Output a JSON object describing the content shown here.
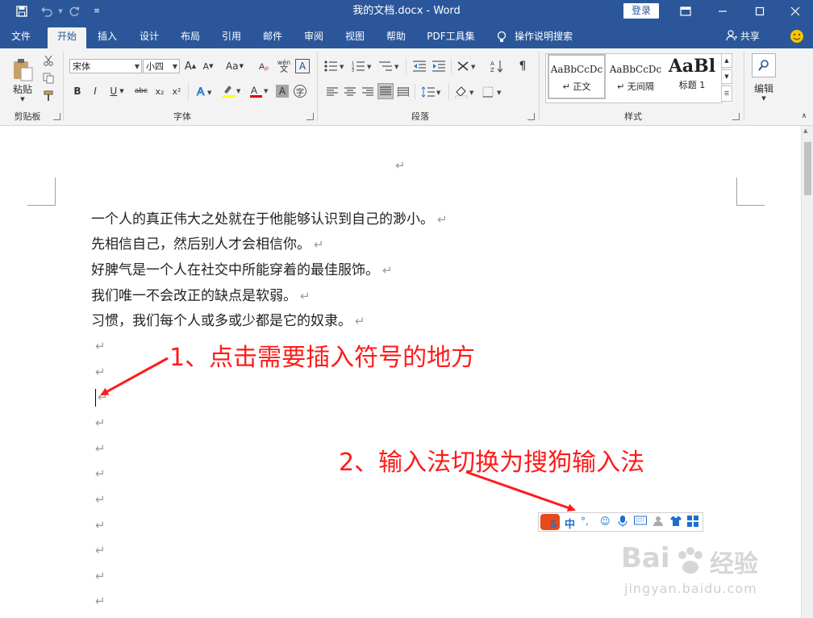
{
  "titlebar": {
    "title": "我的文档.docx - Word",
    "login_label": "登录"
  },
  "tabs": [
    "文件",
    "开始",
    "插入",
    "设计",
    "布局",
    "引用",
    "邮件",
    "审阅",
    "视图",
    "帮助",
    "PDF工具集",
    "操作说明搜索"
  ],
  "share_label": "共享",
  "ribbon": {
    "clipboard": {
      "paste_label": "粘贴",
      "group_label": "剪贴板"
    },
    "font": {
      "font_name": "宋体",
      "font_size": "小四",
      "group_label": "字体",
      "grow": "A",
      "shrink": "A",
      "case": "Aa",
      "wen": "wén",
      "bold": "B",
      "italic": "I",
      "underline": "U",
      "strike": "abc",
      "sub": "x₂",
      "sup": "x²"
    },
    "paragraph": {
      "group_label": "段落"
    },
    "styles": {
      "group_label": "样式",
      "items": [
        {
          "preview": "AaBbCcDc",
          "name": "↵ 正文"
        },
        {
          "preview": "AaBbCcDc",
          "name": "↵ 无间隔"
        },
        {
          "preview": "AaBl",
          "name": "标题 1"
        }
      ]
    },
    "editing": {
      "label": "编辑"
    }
  },
  "document": {
    "top_mark": "↵",
    "paragraphs": [
      "一个人的真正伟大之处就在于他能够认识到自己的渺小。",
      "先相信自己，然后别人才会相信你。",
      "好脾气是一个人在社交中所能穿着的最佳服饰。",
      "我们唯一不会改正的缺点是软弱。",
      "习惯，我们每个人或多或少都是它的奴隶。"
    ],
    "mark": "↵"
  },
  "annotations": {
    "step1": "1、点击需要插入符号的地方",
    "step2": "2、输入法切换为搜狗输入法",
    "color": "#ff1a1a"
  },
  "ime": {
    "logo": "S",
    "mode": "中",
    "punct": "°,"
  },
  "watermark": {
    "brand": "Bai",
    "brand2": "经验",
    "url": "jingyan.baidu.com"
  },
  "colors": {
    "accent": "#2b579a",
    "ribbon": "#f3f3f3"
  }
}
